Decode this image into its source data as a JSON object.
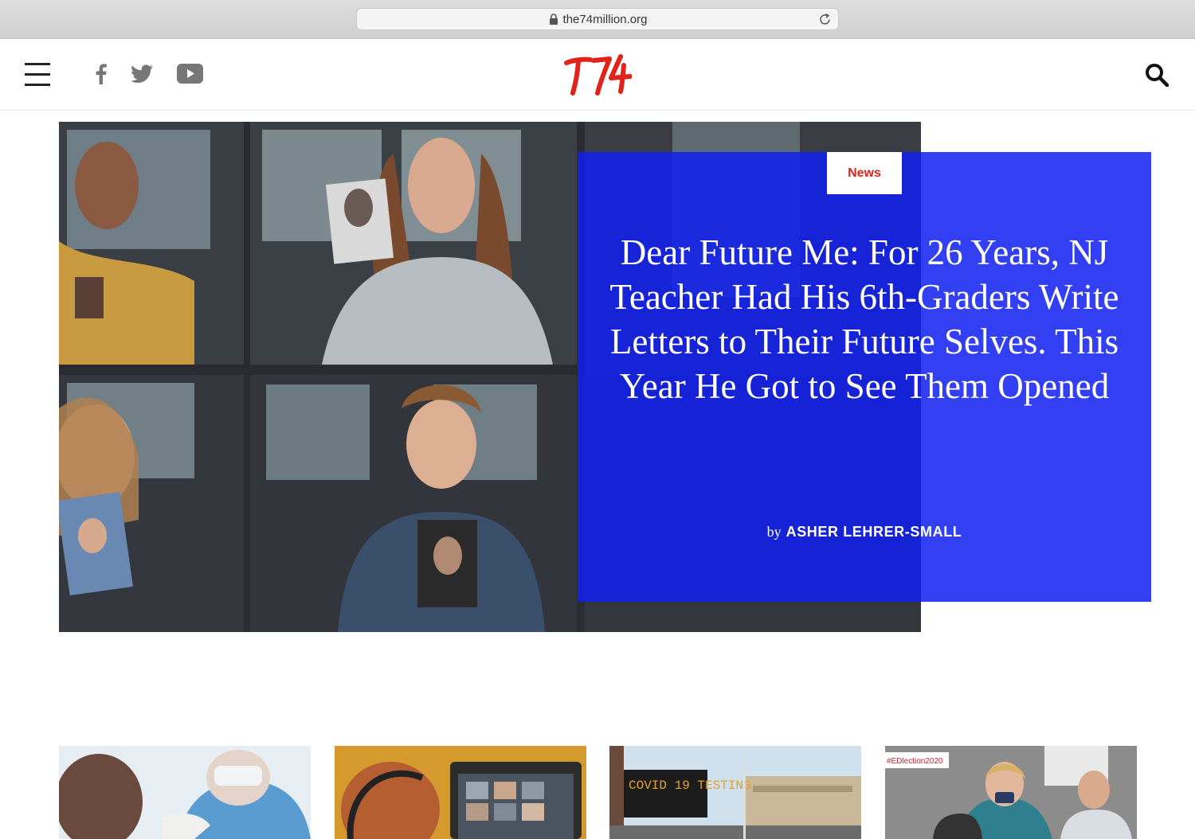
{
  "browser": {
    "url": "the74million.org"
  },
  "header": {
    "logo_text": "T74",
    "social": [
      "facebook-icon",
      "twitter-icon",
      "youtube-icon"
    ]
  },
  "hero": {
    "category": "News",
    "headline": "Dear Future Me: For 26 Years, NJ Teacher Had His 6th-Graders Write Letters to Their Future Selves. This Year He Got to See Them Opened",
    "byline_prefix": "by",
    "author": "ASHER LEHRER-SMALL"
  },
  "cards": [
    {
      "image_text": ""
    },
    {
      "image_text": ""
    },
    {
      "image_text": "COVID 19 TESTING"
    },
    {
      "image_text": "#EDlection2020"
    }
  ],
  "colors": {
    "brand_red": "#e2231a",
    "card_blue": "#1220f0"
  }
}
